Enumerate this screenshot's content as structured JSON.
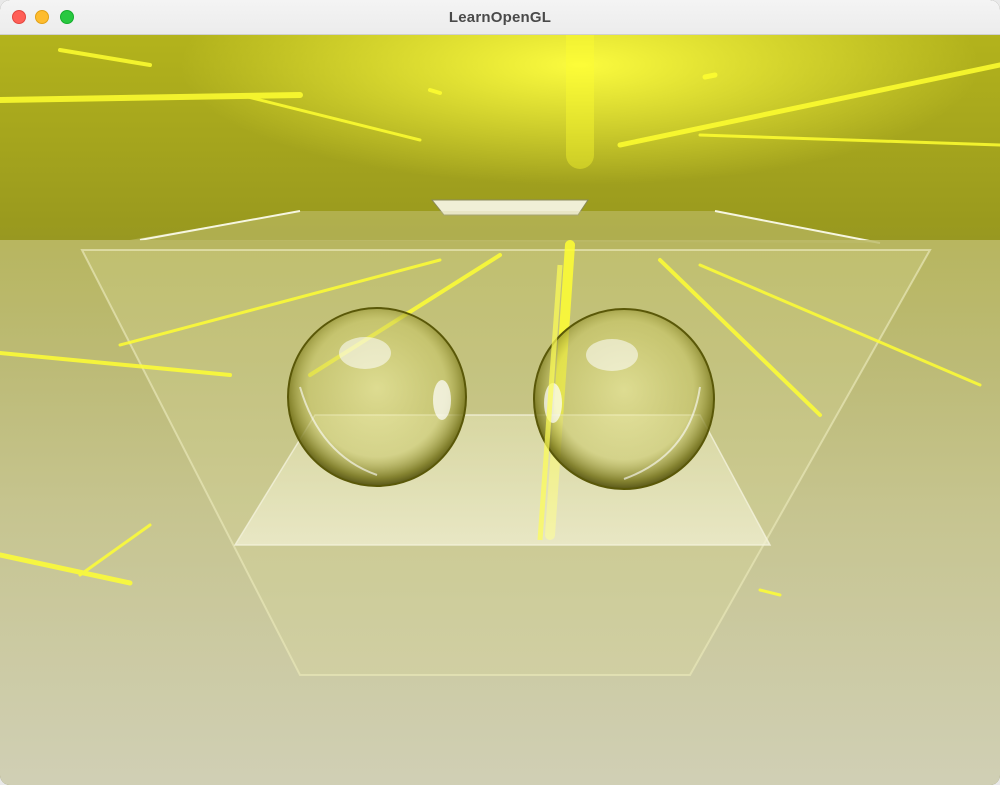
{
  "window": {
    "title": "LearnOpenGL"
  },
  "scene": {
    "description_colors": {
      "tint": "#e6e000",
      "highlight": "#ffff66",
      "floor": "#d8d8c4"
    },
    "objects": [
      "skybox",
      "reflective-floor",
      "glass-sphere-left",
      "glass-sphere-right",
      "transparent-box"
    ]
  }
}
